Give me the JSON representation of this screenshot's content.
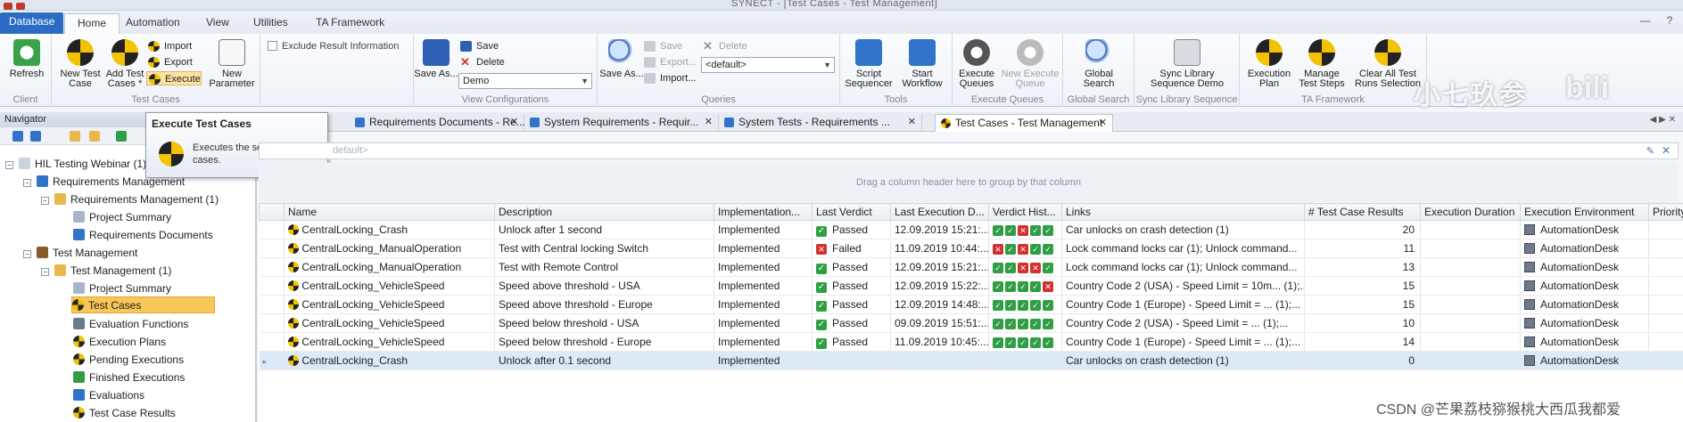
{
  "window": {
    "title": "SYNECT - [Test Cases - Test Management]"
  },
  "ribbon_tabs": [
    {
      "label": "Database"
    },
    {
      "label": "Home"
    },
    {
      "label": "Automation"
    },
    {
      "label": "View"
    },
    {
      "label": "Utilities"
    },
    {
      "label": "TA Framework"
    }
  ],
  "ribbon": {
    "client": {
      "group": "Client",
      "refresh": "Refresh"
    },
    "test_cases": {
      "group": "Test Cases",
      "new_test_case": "New Test Case",
      "add_test_cases": "Add Test Cases *",
      "import": "Import",
      "export": "Export",
      "execute": "Execute",
      "new_parameter": "New Parameter"
    },
    "exclude_result": "Exclude Result Information",
    "view_configurations": {
      "group": "View Configurations",
      "save_as": "Save As...",
      "save": "Save",
      "delete": "Delete",
      "selected": "Demo"
    },
    "queries": {
      "group": "Queries",
      "save_as": "Save As...",
      "save": "Save",
      "export": "Export...",
      "import": "Import...",
      "delete": "Delete",
      "selected": "<default>"
    },
    "tools": {
      "group": "Tools",
      "script_sequencer": "Script Sequencer",
      "start_workflow": "Start Workflow"
    },
    "execute_queues": {
      "group": "Execute Queues",
      "execute_queues": "Execute Queues",
      "new_execute_queue": "New Execute Queue"
    },
    "global_search": {
      "group": "Global Search",
      "global_search": "Global Search"
    },
    "sync_library": {
      "group": "Sync Library Sequence",
      "sync_library": "Sync Library Sequence Demo"
    },
    "ta_framework": {
      "group": "TA Framework",
      "execution_plan": "Execution Plan",
      "manage_test_steps": "Manage Test Steps",
      "clear_all": "Clear All Test Runs Selection"
    }
  },
  "watermark": {
    "text": "小七玖参",
    "logo": "bili"
  },
  "tooltip": {
    "title": "Execute Test Cases",
    "description": "Executes the selected test cases."
  },
  "navigator": {
    "title": "Navigator",
    "tree": [
      {
        "label": "HIL Testing Webinar (1)"
      },
      {
        "label": "Requirements Management"
      },
      {
        "label": "Requirements Management (1)"
      },
      {
        "label": "Project Summary"
      },
      {
        "label": "Requirements Documents"
      },
      {
        "label": "Test Management"
      },
      {
        "label": "Test Management (1)"
      },
      {
        "label": "Project Summary"
      },
      {
        "label": "Test Cases"
      },
      {
        "label": "Evaluation Functions"
      },
      {
        "label": "Execution Plans"
      },
      {
        "label": "Pending Executions"
      },
      {
        "label": "Finished Executions"
      },
      {
        "label": "Evaluations"
      },
      {
        "label": "Test Case Results"
      }
    ]
  },
  "doc_tabs": [
    {
      "label": "Requirements Documents - Re..."
    },
    {
      "label": "System Requirements - Requir..."
    },
    {
      "label": "System Tests - Requirements ..."
    },
    {
      "label": "Test Cases - Test Management"
    }
  ],
  "filter": {
    "placeholder": "default>"
  },
  "group_hint": "Drag a column header here to group by that column",
  "grid": {
    "columns": [
      "Name",
      "Description",
      "Implementation...",
      "Last Verdict",
      "Last Execution D...",
      "Verdict Hist...",
      "Links",
      "# Test Case Results",
      "Execution Duration",
      "Execution Environment",
      "Priority"
    ],
    "rows": [
      {
        "name": "CentralLocking_Crash",
        "description": "Unlock after 1 second",
        "implementation": "Implemented",
        "verdict": "Passed",
        "last_exec": "12.09.2019 15:21:...",
        "history": [
          "p",
          "p",
          "f",
          "p",
          "p"
        ],
        "links": "Car unlocks on crash detection (1)",
        "results": "20",
        "duration": "",
        "environment": "AutomationDesk",
        "priority": ""
      },
      {
        "name": "CentralLocking_ManualOperation",
        "description": "Test with Central locking Switch",
        "implementation": "Implemented",
        "verdict": "Failed",
        "last_exec": "11.09.2019 10:44:...",
        "history": [
          "f",
          "p",
          "f",
          "p",
          "p"
        ],
        "links": "Lock command locks car (1); Unlock command...",
        "results": "11",
        "duration": "",
        "environment": "AutomationDesk",
        "priority": ""
      },
      {
        "name": "CentralLocking_ManualOperation",
        "description": "Test with Remote Control",
        "implementation": "Implemented",
        "verdict": "Passed",
        "last_exec": "12.09.2019 15:21:...",
        "history": [
          "p",
          "p",
          "f",
          "f",
          "p"
        ],
        "links": "Lock command locks car (1); Unlock command...",
        "results": "13",
        "duration": "",
        "environment": "AutomationDesk",
        "priority": ""
      },
      {
        "name": "CentralLocking_VehicleSpeed",
        "description": "Speed above threshold - USA",
        "implementation": "Implemented",
        "verdict": "Passed",
        "last_exec": "12.09.2019 15:22:...",
        "history": [
          "p",
          "p",
          "p",
          "p",
          "f"
        ],
        "links": "Country Code 2 (USA) - Speed Limit = 10m... (1);...",
        "results": "15",
        "duration": "",
        "environment": "AutomationDesk",
        "priority": ""
      },
      {
        "name": "CentralLocking_VehicleSpeed",
        "description": "Speed above threshold - Europe",
        "implementation": "Implemented",
        "verdict": "Passed",
        "last_exec": "12.09.2019 14:48:...",
        "history": [
          "p",
          "p",
          "p",
          "p",
          "p"
        ],
        "links": "Country Code 1 (Europe) - Speed Limit = ... (1);...",
        "results": "15",
        "duration": "",
        "environment": "AutomationDesk",
        "priority": ""
      },
      {
        "name": "CentralLocking_VehicleSpeed",
        "description": "Speed below threshold - USA",
        "implementation": "Implemented",
        "verdict": "Passed",
        "last_exec": "09.09.2019 15:51:...",
        "history": [
          "p",
          "p",
          "p",
          "p",
          "p"
        ],
        "links": "Country Code 2 (USA) - Speed Limit = ... (1);...",
        "results": "10",
        "duration": "",
        "environment": "AutomationDesk",
        "priority": ""
      },
      {
        "name": "CentralLocking_VehicleSpeed",
        "description": "Speed below threshold - Europe",
        "implementation": "Implemented",
        "verdict": "Passed",
        "last_exec": "11.09.2019 10:45:...",
        "history": [
          "p",
          "p",
          "p",
          "p",
          "p"
        ],
        "links": "Country Code 1 (Europe) - Speed Limit = ... (1);...",
        "results": "14",
        "duration": "",
        "environment": "AutomationDesk",
        "priority": ""
      },
      {
        "name": "CentralLocking_Crash",
        "description": "Unlock after 0.1 second",
        "implementation": "Implemented",
        "verdict": "",
        "last_exec": "",
        "history": [],
        "links": "Car unlocks on crash detection (1)",
        "results": "0",
        "duration": "",
        "environment": "AutomationDesk",
        "priority": ""
      }
    ]
  },
  "footer_watermark": "CSDN @芒果荔枝猕猴桃大西瓜我都爱",
  "colors": {
    "accent": "#2a6cc4",
    "pass": "#2f9e44",
    "fail": "#d33030",
    "selected_node": "#f8c75a",
    "highlight_row": "#dce9f8"
  }
}
